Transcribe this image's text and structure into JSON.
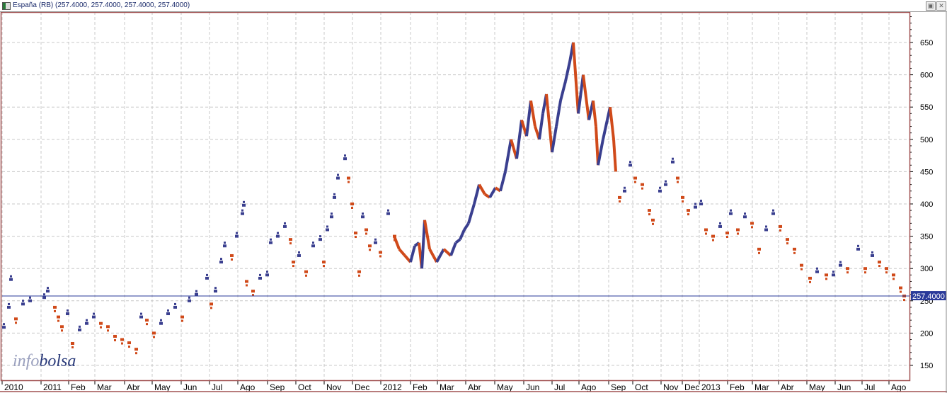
{
  "window": {
    "title": "España (RB) (257.4000, 257.4000, 257.4000, 257.4000)"
  },
  "watermark": {
    "part1": "info",
    "part2": "bolsa"
  },
  "colors": {
    "up": "#3a3f8f",
    "down": "#d04a1a",
    "frame": "#a05050",
    "grid": "#c8c8c8",
    "last": "#2a3a9a"
  },
  "chart_data": {
    "type": "line",
    "title": "España (RB)",
    "last_value": 257.4,
    "last_label": "257.4000",
    "ylim": [
      130,
      700
    ],
    "yticks": [
      150,
      200,
      250,
      300,
      350,
      400,
      450,
      500,
      550,
      600,
      650
    ],
    "xticks": [
      "2010",
      "2011",
      "Feb",
      "Mar",
      "Abr",
      "May",
      "Jun",
      "Jul",
      "Ago",
      "Sep",
      "Oct",
      "Nov",
      "Dec",
      "2012",
      "Feb",
      "Mar",
      "Abr",
      "May",
      "Jun",
      "Jul",
      "Ago",
      "Sep",
      "Oct",
      "Nov",
      "Dec",
      "2013",
      "Feb",
      "Mar",
      "Abr",
      "May",
      "Jun",
      "Jul",
      "Ago"
    ],
    "xtick_t": [
      3,
      58,
      97,
      134,
      176,
      215,
      256,
      296,
      336,
      378,
      418,
      458,
      498,
      538,
      580,
      618,
      658,
      699,
      740,
      780,
      818,
      860,
      894,
      934,
      964,
      988,
      1028,
      1063,
      1100,
      1140,
      1180,
      1218,
      1256
    ],
    "t": [
      3,
      10,
      13,
      20,
      30,
      40,
      60,
      65,
      75,
      80,
      85,
      93,
      100,
      110,
      120,
      130,
      140,
      150,
      160,
      170,
      180,
      190,
      197,
      205,
      215,
      225,
      235,
      245,
      255,
      265,
      275,
      290,
      296,
      302,
      310,
      315,
      325,
      332,
      340,
      342,
      346,
      355,
      365,
      375,
      380,
      390,
      400,
      408,
      412,
      420,
      430,
      440,
      450,
      455,
      460,
      466,
      470,
      475,
      485,
      490,
      495,
      500,
      505,
      510,
      515,
      520,
      528,
      535,
      546,
      555,
      562,
      570,
      578,
      584,
      590,
      594,
      598,
      605,
      615,
      625,
      635,
      642,
      648,
      654,
      660,
      668,
      675,
      683,
      690,
      698,
      705,
      712,
      720,
      728,
      735,
      742,
      748,
      754,
      760,
      765,
      770,
      778,
      784,
      790,
      797,
      803,
      808,
      815,
      822,
      830,
      836,
      840,
      843,
      850,
      856,
      860,
      865,
      868,
      873,
      880,
      888,
      895,
      905,
      915,
      920,
      930,
      938,
      948,
      955,
      962,
      970,
      980,
      988,
      995,
      1005,
      1015,
      1025,
      1030,
      1040,
      1050,
      1060,
      1070,
      1080,
      1090,
      1100,
      1110,
      1120,
      1130,
      1142,
      1152,
      1165,
      1175,
      1185,
      1195,
      1210,
      1220,
      1230,
      1240,
      1250,
      1260,
      1270,
      1275
    ],
    "values": [
      209,
      240,
      283,
      222,
      245,
      250,
      255,
      265,
      240,
      225,
      210,
      230,
      184,
      205,
      215,
      225,
      215,
      210,
      195,
      190,
      185,
      175,
      225,
      220,
      200,
      215,
      230,
      240,
      225,
      250,
      260,
      285,
      245,
      265,
      310,
      335,
      320,
      350,
      385,
      398,
      280,
      265,
      285,
      290,
      340,
      350,
      365,
      345,
      310,
      320,
      295,
      335,
      345,
      310,
      360,
      380,
      410,
      440,
      470,
      440,
      400,
      355,
      295,
      380,
      360,
      335,
      340,
      325,
      385,
      350,
      330,
      320,
      310,
      335,
      340,
      300,
      375,
      330,
      310,
      330,
      320,
      340,
      345,
      360,
      370,
      400,
      430,
      415,
      410,
      425,
      420,
      450,
      500,
      470,
      530,
      505,
      560,
      520,
      500,
      540,
      570,
      480,
      520,
      560,
      590,
      620,
      650,
      540,
      600,
      530,
      560,
      520,
      460,
      500,
      530,
      550,
      500,
      450,
      410,
      420,
      460,
      440,
      430,
      390,
      375,
      420,
      430,
      465,
      440,
      410,
      390,
      395,
      400,
      360,
      350,
      365,
      355,
      385,
      360,
      380,
      370,
      330,
      360,
      385,
      365,
      345,
      330,
      305,
      285,
      295,
      290,
      290,
      305,
      300,
      330,
      300,
      320,
      310,
      300,
      290,
      270,
      257.4
    ]
  }
}
